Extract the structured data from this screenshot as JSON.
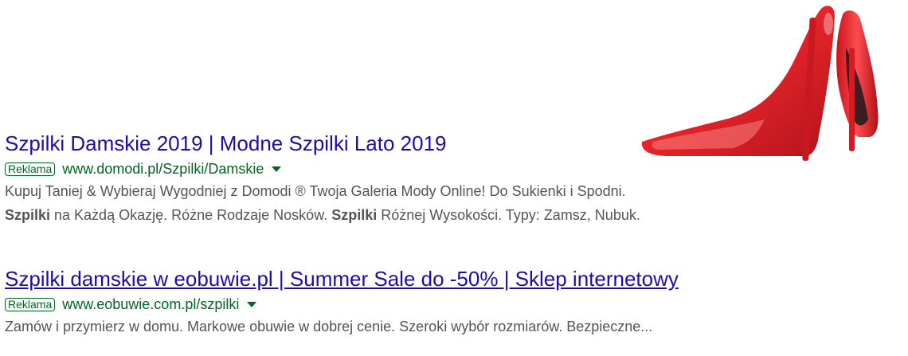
{
  "ads": [
    {
      "title": "Szpilki Damskie 2019 | Modne Szpilki Lato 2019",
      "badge": "Reklama",
      "url": "www.domodi.pl/Szpilki/Damskie",
      "desc_line1": "Kupuj Taniej & Wybieraj Wygodniej z Domodi ® Twoja Galeria Mody Online! Do Sukienki i Spodni.",
      "desc_line2": [
        {
          "text": "Szpilki",
          "bold": true
        },
        {
          "text": " na Każdą Okazję. Różne Rodzaje Nosków. ",
          "bold": false
        },
        {
          "text": "Szpilki",
          "bold": true
        },
        {
          "text": " Różnej Wysokości. Typy: Zamsz, Nubuk.",
          "bold": false
        }
      ]
    },
    {
      "title": "Szpilki damskie w eobuwie.pl | Summer Sale do -50% | Sklep internetowy",
      "badge": "Reklama",
      "url": "www.eobuwie.com.pl/szpilki",
      "desc_line1": "Zamów i przymierz w domu. Markowe obuwie w dobrej cenie. Szeroki wybór rozmiarów. Bezpieczne..."
    }
  ],
  "colors": {
    "title": "#1a0dab",
    "url": "#006621",
    "description": "#545454",
    "shoe": "#e8262b"
  },
  "icons": {
    "url_dropdown": "triangle-down",
    "product_image": "red-high-heels"
  }
}
